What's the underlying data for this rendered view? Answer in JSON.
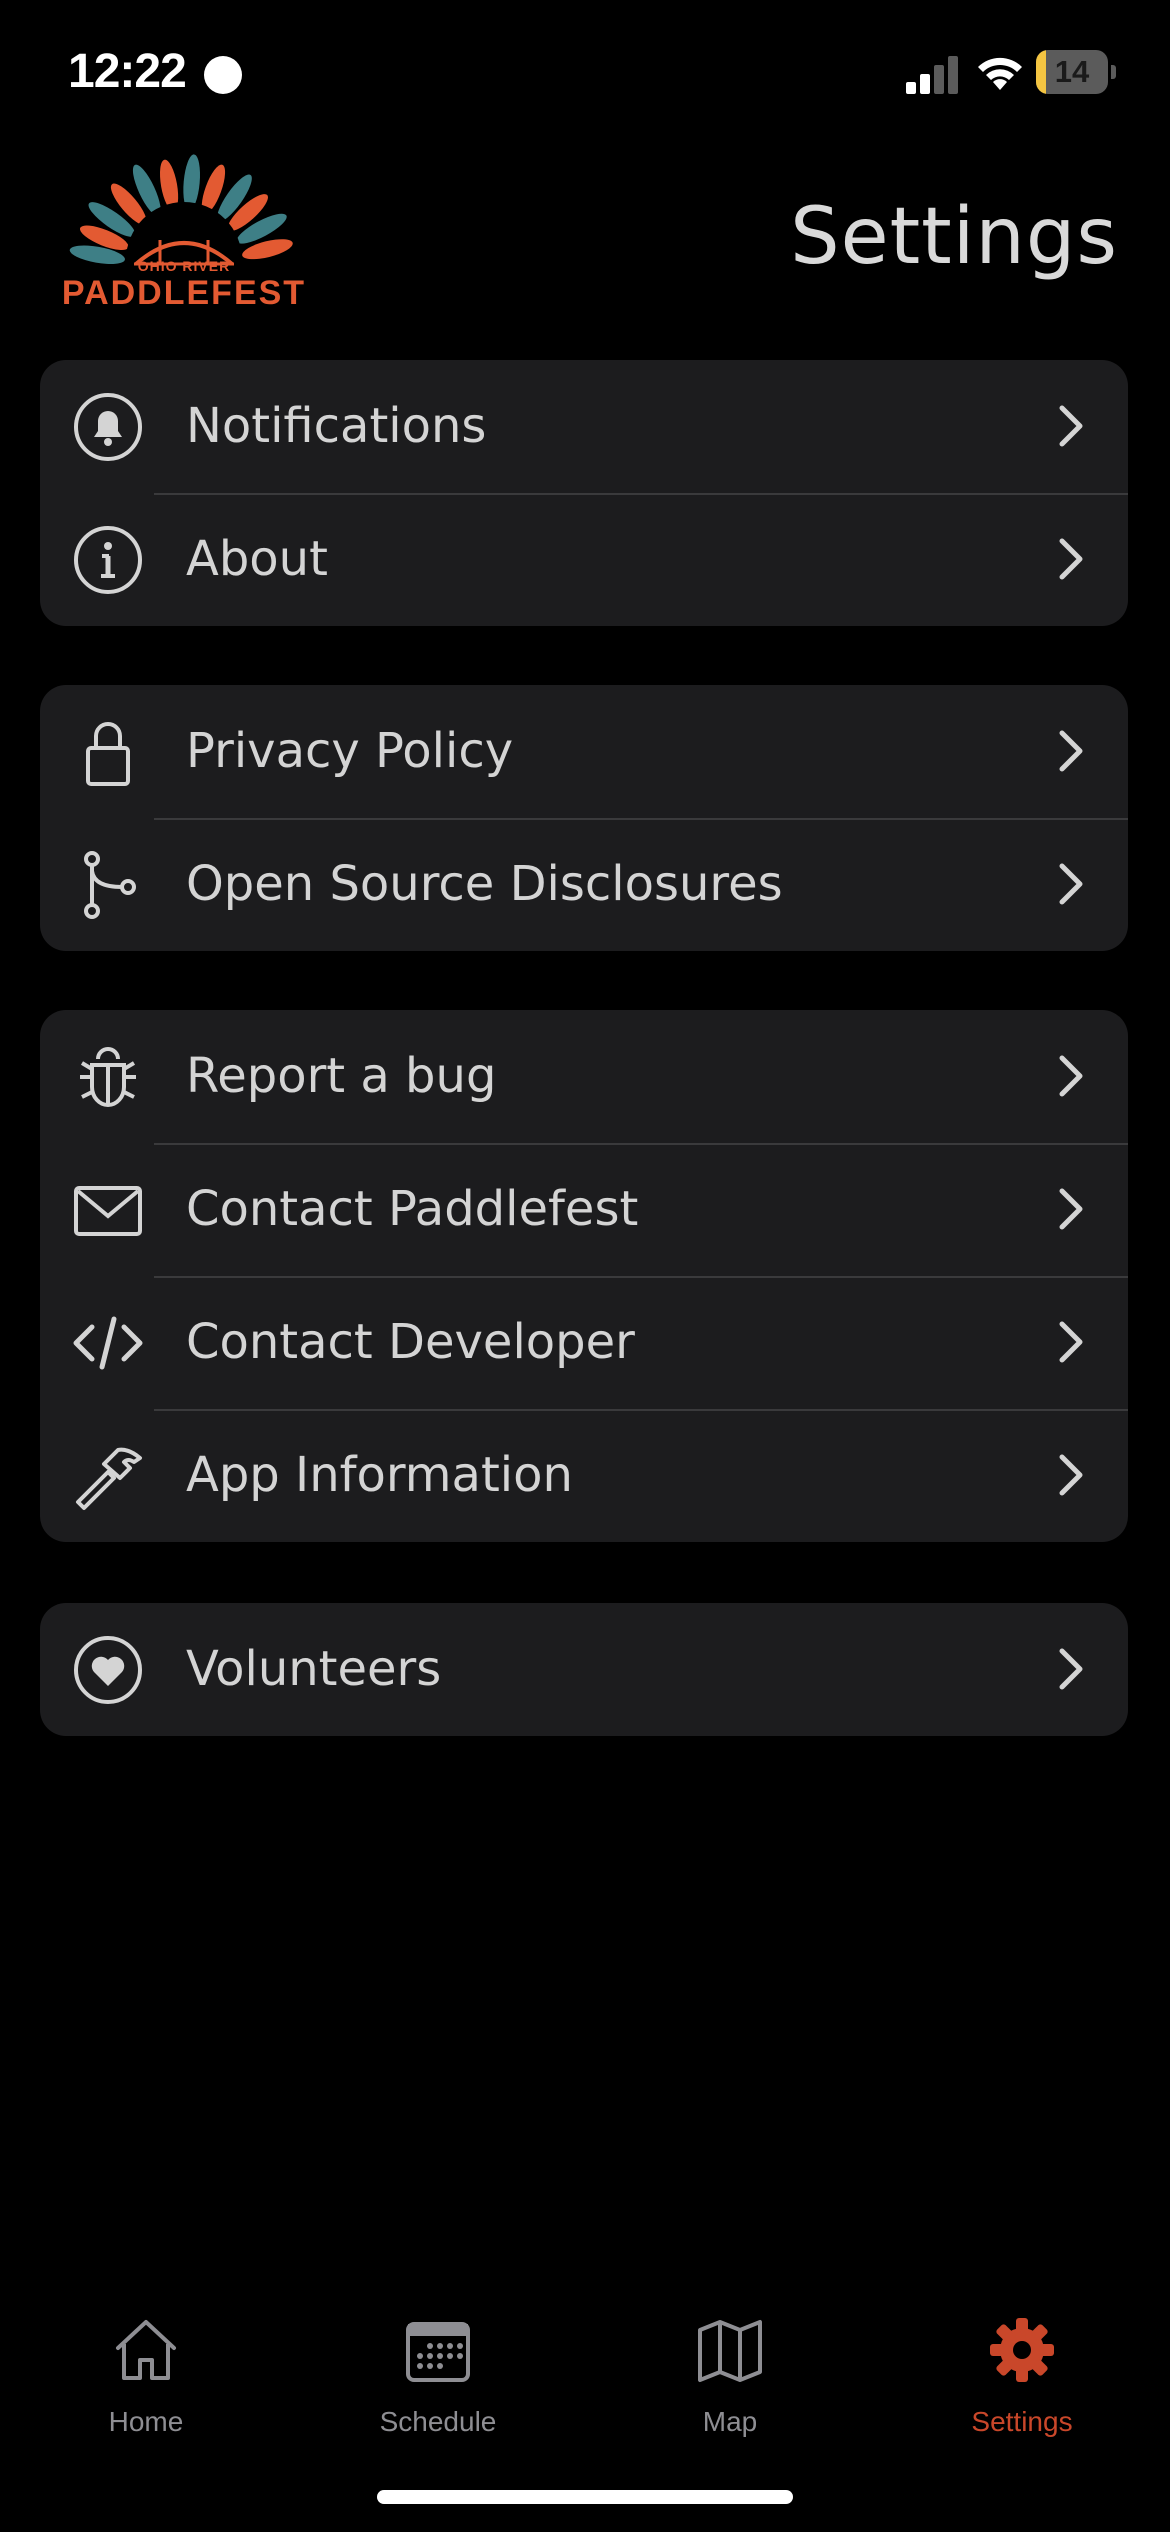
{
  "status_bar": {
    "time": "12:22",
    "battery_level": "14",
    "battery_fraction": 0.14,
    "signal_icon": "cellular-signal-icon",
    "wifi_icon": "wifi-icon"
  },
  "header": {
    "logo_name": "OHIO RIVER",
    "logo_text": "PADDLEFEST",
    "title": "Settings"
  },
  "groups": [
    {
      "items": [
        {
          "label": "Notifications",
          "icon": "bell-icon"
        },
        {
          "label": "About",
          "icon": "info-icon"
        }
      ]
    },
    {
      "items": [
        {
          "label": "Privacy Policy",
          "icon": "lock-icon"
        },
        {
          "label": "Open Source Disclosures",
          "icon": "branch-icon"
        }
      ]
    },
    {
      "items": [
        {
          "label": "Report a bug",
          "icon": "bug-icon"
        },
        {
          "label": "Contact Paddlefest",
          "icon": "envelope-icon"
        },
        {
          "label": "Contact Developer",
          "icon": "code-icon"
        },
        {
          "label": "App Information",
          "icon": "hammer-icon"
        }
      ]
    },
    {
      "items": [
        {
          "label": "Volunteers",
          "icon": "heart-icon"
        }
      ]
    }
  ],
  "tab_bar": {
    "tabs": [
      {
        "label": "Home",
        "icon": "house-icon"
      },
      {
        "label": "Schedule",
        "icon": "calendar-icon"
      },
      {
        "label": "Map",
        "icon": "map-icon"
      },
      {
        "label": "Settings",
        "icon": "gear-icon",
        "active": true
      }
    ]
  },
  "colors": {
    "background": "#000000",
    "group_background": "#1c1c1e",
    "separator": "#3a3a3c",
    "text": "#d4d4d4",
    "accent": "#c9472a",
    "tab_inactive": "#8e8e93",
    "logo_orange": "#e35a32",
    "logo_teal": "#3e7f86"
  }
}
